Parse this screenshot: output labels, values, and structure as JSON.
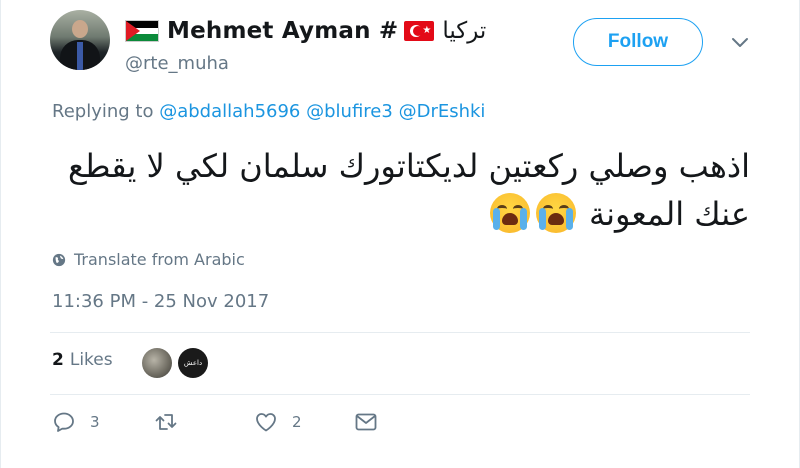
{
  "user": {
    "display_name": "Mehmet Ayman #",
    "name_arabic": "تركيا",
    "handle": "@rte_muha"
  },
  "follow_label": "Follow",
  "replying": {
    "prefix": "Replying to",
    "mentions": [
      "@abdallah5696",
      "@blufire3",
      "@DrEshki"
    ]
  },
  "tweet": {
    "line1": "اذهب وصلي ركعتين لديكتاتورك سلمان لكي لا يقطع",
    "line2": "عنك المعونة"
  },
  "translate_label": "Translate from Arabic",
  "timestamp": "11:36 PM - 25 Nov 2017",
  "likes": {
    "count": "2",
    "label": "Likes"
  },
  "liker_b_text": "داعش",
  "actions": {
    "reply_count": "3",
    "like_count": "2"
  },
  "colors": {
    "accent": "#1da1f2",
    "muted": "#657786",
    "text": "#14171a",
    "mention": "#1b95e0"
  },
  "icons": [
    "palestine-flag-icon",
    "turkey-flag-icon",
    "chevron-down-icon",
    "globe-icon",
    "loudly-crying-face-emoji",
    "reply-icon",
    "retweet-icon",
    "heart-icon",
    "envelope-icon"
  ]
}
